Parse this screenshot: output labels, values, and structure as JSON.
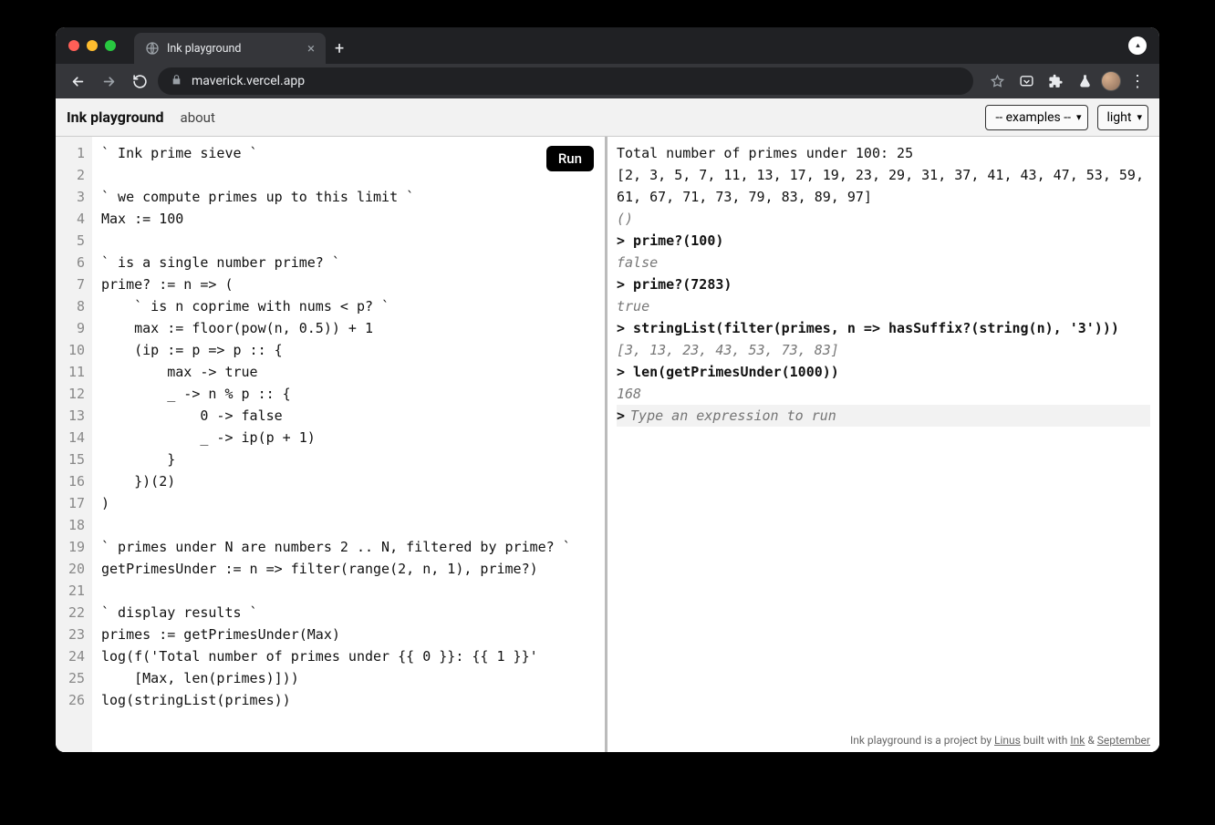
{
  "browser": {
    "tab_title": "Ink playground",
    "url": "maverick.vercel.app"
  },
  "header": {
    "title": "Ink playground",
    "about_label": "about",
    "examples_selected": "-- examples --",
    "theme_selected": "light"
  },
  "editor": {
    "run_label": "Run",
    "lines": [
      "` Ink prime sieve `",
      "",
      "` we compute primes up to this limit `",
      "Max := 100",
      "",
      "` is a single number prime? `",
      "prime? := n => (",
      "    ` is n coprime with nums < p? `",
      "    max := floor(pow(n, 0.5)) + 1",
      "    (ip := p => p :: {",
      "        max -> true",
      "        _ -> n % p :: {",
      "            0 -> false",
      "            _ -> ip(p + 1)",
      "        }",
      "    })(2)",
      ")",
      "",
      "` primes under N are numbers 2 .. N, filtered by prime? `",
      "getPrimesUnder := n => filter(range(2, n, 1), prime?)",
      "",
      "` display results `",
      "primes := getPrimesUnder(Max)",
      "log(f('Total number of primes under {{ 0 }}: {{ 1 }}'",
      "    [Max, len(primes)]))",
      "log(stringList(primes))"
    ]
  },
  "repl": {
    "output_lines": [
      "Total number of primes under 100: 25",
      "[2, 3, 5, 7, 11, 13, 17, 19, 23, 29, 31, 37, 41, 43, 47, 53, 59, 61, 67, 71, 73, 79, 83, 89, 97]"
    ],
    "output_trailer": "()",
    "entries": [
      {
        "in": "prime?(100)",
        "out": "false"
      },
      {
        "in": "prime?(7283)",
        "out": "true"
      },
      {
        "in": "stringList(filter(primes, n => hasSuffix?(string(n), '3')))",
        "out": "[3, 13, 23, 43, 53, 73, 83]"
      },
      {
        "in": "len(getPrimesUnder(1000))",
        "out": "168"
      }
    ],
    "prompt": ">",
    "placeholder": "Type an expression to run"
  },
  "footer": {
    "prefix": "Ink playground is a project by ",
    "author": "Linus",
    "mid1": " built with ",
    "link1": "Ink",
    "amp": " & ",
    "link2": "September"
  }
}
